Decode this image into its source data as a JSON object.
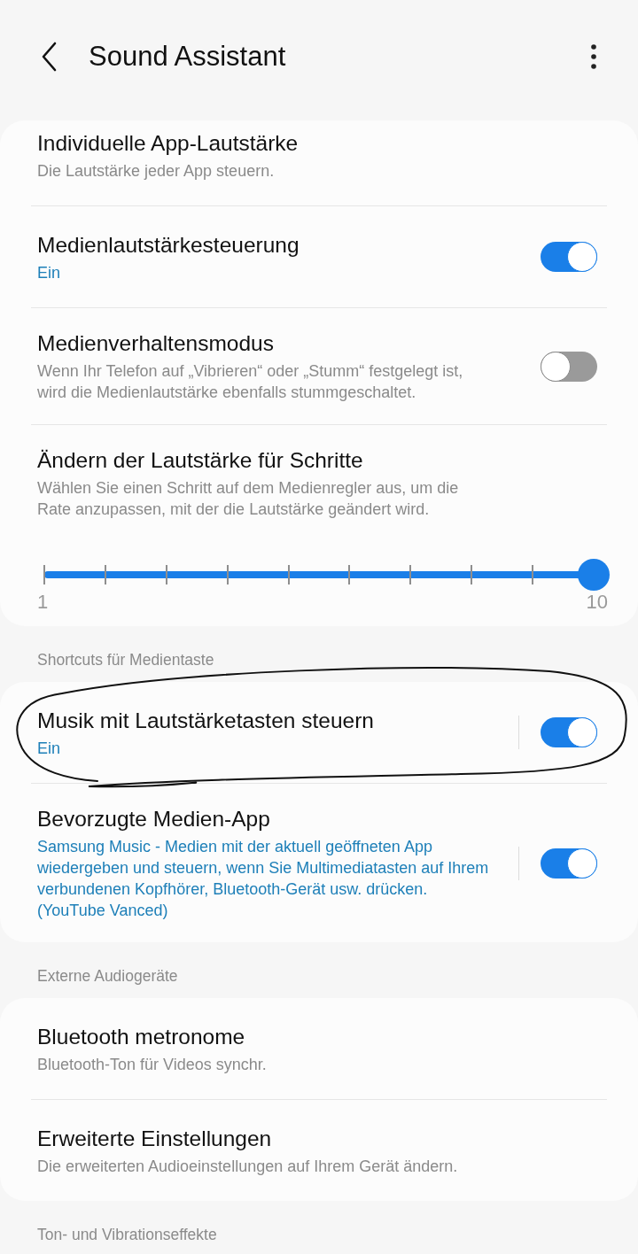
{
  "header": {
    "title": "Sound Assistant"
  },
  "groups": [
    {
      "items": [
        {
          "kind": "link",
          "title": "Individuelle App-Lautstärke",
          "summary": "Die Lautstärke jeder App steuern.",
          "summary_accent": false
        },
        {
          "kind": "switch",
          "title": "Medienlautstärkesteuerung",
          "summary": "Ein",
          "summary_accent": true,
          "on": true,
          "divider": false,
          "circled": false
        },
        {
          "kind": "switch",
          "title": "Medienverhaltensmodus",
          "summary": "Wenn Ihr Telefon auf „Vibrieren“ oder „Stumm“ festgelegt ist, wird die Medienlautstärke ebenfalls stummgeschaltet.",
          "summary_accent": false,
          "on": false,
          "divider": false,
          "circled": false
        },
        {
          "kind": "slider",
          "title": "Ändern der Lautstärke für Schritte",
          "summary": "Wählen Sie einen Schritt auf dem Medienregler aus, um die Rate anzupassen, mit der die Lautstärke geändert wird.",
          "summary_accent": false,
          "level": 1,
          "min_label": "1",
          "max_label": "10"
        }
      ]
    },
    {
      "header": "Shortcuts für Medientaste",
      "items": [
        {
          "kind": "switch",
          "title": "Musik mit Lautstärketasten steuern",
          "summary": "Ein",
          "summary_accent": true,
          "on": true,
          "divider": true,
          "circled": true
        },
        {
          "kind": "switch",
          "title": "Bevorzugte Medien-App",
          "summary": "Samsung Music - Medien mit der aktuell geöffneten App wiedergeben und steuern, wenn Sie Multimediatasten auf Ihrem verbundenen Kopfhörer, Bluetooth-Gerät usw. drücken. (YouTube Vanced)",
          "summary_accent": true,
          "on": true,
          "divider": true,
          "circled": false
        }
      ]
    },
    {
      "header": "Externe Audiogeräte",
      "items": [
        {
          "kind": "link",
          "title": "Bluetooth metronome",
          "summary": "Bluetooth-Ton für Videos synchr.",
          "summary_accent": false
        },
        {
          "kind": "link",
          "title": "Erweiterte Einstellungen",
          "summary": "Die erweiterten Audioeinstellungen auf Ihrem Gerät ändern.",
          "summary_accent": false
        }
      ]
    },
    {
      "header": "Ton- und Vibrationseffekte"
    }
  ]
}
